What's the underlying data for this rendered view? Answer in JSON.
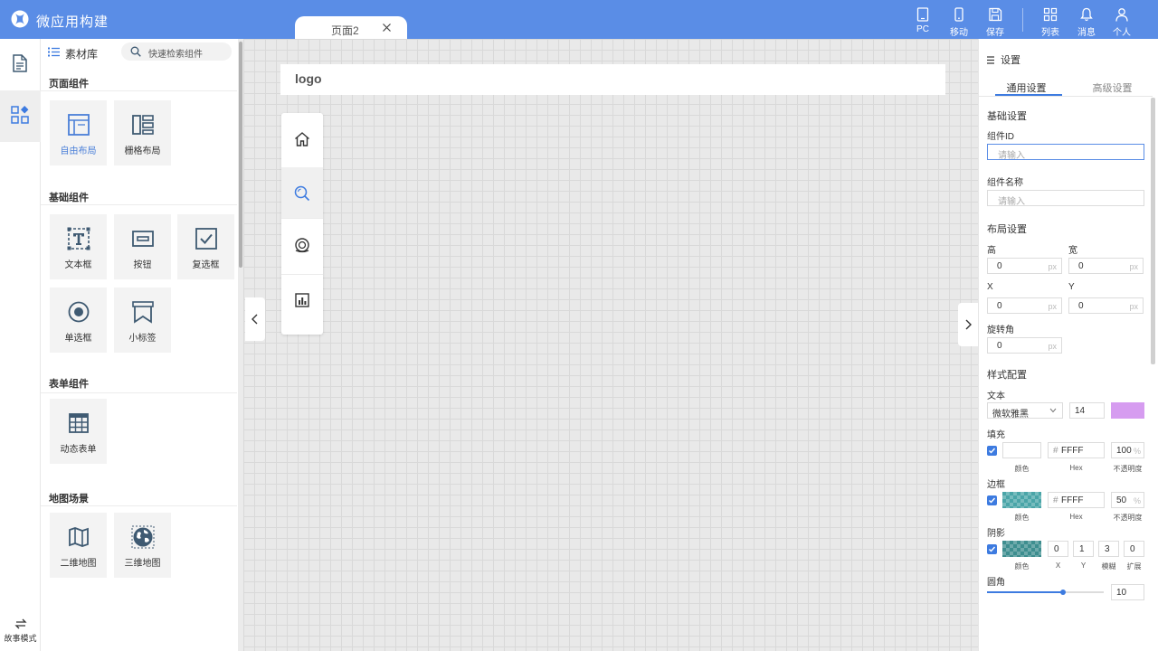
{
  "app": {
    "title": "微应用构建"
  },
  "tab": {
    "label": "页面2"
  },
  "toolbar": [
    {
      "label": "PC",
      "icon": "tablet-icon"
    },
    {
      "label": "移动",
      "icon": "mobile-icon"
    },
    {
      "label": "保存",
      "icon": "save-icon"
    },
    {
      "label": "列表",
      "icon": "grid-icon"
    },
    {
      "label": "消息",
      "icon": "bell-icon"
    },
    {
      "label": "个人",
      "icon": "user-icon"
    }
  ],
  "sidebar": {
    "story_mode": "故事模式"
  },
  "library": {
    "title": "素材库",
    "search_placeholder": "快速检索组件",
    "sections": [
      {
        "title": "页面组件",
        "items": [
          {
            "label": "自由布局",
            "icon": "free-layout-icon",
            "active": true
          },
          {
            "label": "栅格布局",
            "icon": "grid-layout-icon"
          }
        ]
      },
      {
        "title": "基础组件",
        "items": [
          {
            "label": "文本框",
            "icon": "textbox-icon"
          },
          {
            "label": "按钮",
            "icon": "button-icon"
          },
          {
            "label": "复选框",
            "icon": "checkbox-icon"
          },
          {
            "label": "单选框",
            "icon": "radio-icon"
          },
          {
            "label": "小标签",
            "icon": "tag-icon"
          }
        ]
      },
      {
        "title": "表单组件",
        "items": [
          {
            "label": "动态表单",
            "icon": "table-icon"
          }
        ]
      },
      {
        "title": "地图场景",
        "items": [
          {
            "label": "二维地图",
            "icon": "map-icon"
          },
          {
            "label": "三维地图",
            "icon": "globe-icon"
          }
        ]
      }
    ]
  },
  "canvas": {
    "logo": "logo",
    "nav_icons": [
      "home-icon",
      "search-icon",
      "orbit-icon",
      "bar-chart-icon"
    ]
  },
  "settings": {
    "title": "设置",
    "tabs": [
      "通用设置",
      "高级设置"
    ],
    "basic": {
      "title": "基础设置",
      "id_label": "组件ID",
      "id_placeholder": "请输入",
      "name_label": "组件名称",
      "name_placeholder": "请输入"
    },
    "layout": {
      "title": "布局设置",
      "height": {
        "label": "高",
        "value": "0",
        "unit": "px"
      },
      "width": {
        "label": "宽",
        "value": "0",
        "unit": "px"
      },
      "x": {
        "label": "X",
        "value": "0",
        "unit": "px"
      },
      "y": {
        "label": "Y",
        "value": "0",
        "unit": "px"
      },
      "rotation": {
        "label": "旋转角",
        "value": "0",
        "unit": "px"
      }
    },
    "style": {
      "title": "样式配置",
      "text": {
        "label": "文本",
        "font": "微软雅黑",
        "size": "14",
        "color": "#d69cf0"
      },
      "fill": {
        "label": "填充",
        "hex": "FFFF",
        "opacity": "100",
        "color_cap": "颜色",
        "hex_cap": "Hex",
        "opacity_cap": "不透明度",
        "checked": true
      },
      "border": {
        "label": "边框",
        "hex": "FFFF",
        "opacity": "50",
        "color_cap": "颜色",
        "hex_cap": "Hex",
        "opacity_cap": "不透明度",
        "checked": true
      },
      "shadow": {
        "label": "阴影",
        "x": "0",
        "y": "1",
        "blur": "3",
        "spread": "0",
        "color_cap": "颜色",
        "x_cap": "X",
        "y_cap": "Y",
        "blur_cap": "模糊",
        "spread_cap": "扩展",
        "checked": true
      },
      "radius": {
        "label": "圆角",
        "value": "10",
        "slider_fraction": 0.65
      }
    },
    "hash": "#",
    "percent": "%"
  },
  "colors": {
    "topbar": "#5a8de6",
    "accent": "#3d7be0",
    "icon": "#3f5a72"
  }
}
